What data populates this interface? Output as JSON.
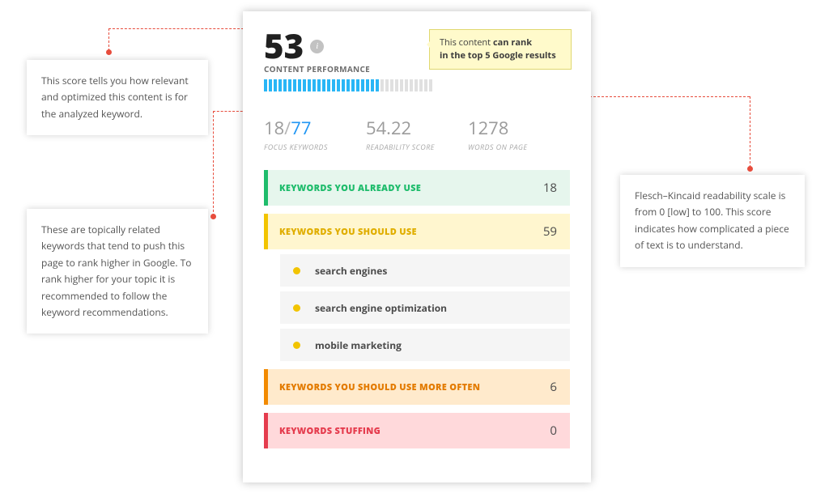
{
  "score": {
    "value": "53",
    "label": "CONTENT PERFORMANCE",
    "filled": 24,
    "total": 35
  },
  "note": {
    "line1": "This content ",
    "bold1": "can rank",
    "line2": "in the top 5 Google results"
  },
  "metrics": {
    "focus": {
      "current": "18",
      "total": "77",
      "label": "FOCUS KEYWORDS"
    },
    "readability": {
      "value": "54.22",
      "label": "READABILITY SCORE"
    },
    "words": {
      "value": "1278",
      "label": "WORDS ON PAGE"
    }
  },
  "sections": {
    "already": {
      "title": "KEYWORDS YOU ALREADY USE",
      "count": "18"
    },
    "should": {
      "title": "KEYWORDS YOU SHOULD USE",
      "count": "59",
      "items": [
        "search engines",
        "search engine optimization",
        "mobile marketing"
      ]
    },
    "often": {
      "title": "KEYWORDS YOU SHOULD USE MORE OFTEN",
      "count": "6"
    },
    "stuffing": {
      "title": "KEYWORDS STUFFING",
      "count": "0"
    }
  },
  "tooltips": {
    "t1": "This score tells you how relevant and optimized this content is for the analyzed keyword.",
    "t2": "These are topically related keywords that tend to push this page to rank higher in Google. To rank higher for your topic it is recommended to follow the keyword recommendations.",
    "t3": "Flesch–Kincaid readability scale is from 0 [low] to 100. This score indicates how complicated a piece of text is to understand."
  }
}
